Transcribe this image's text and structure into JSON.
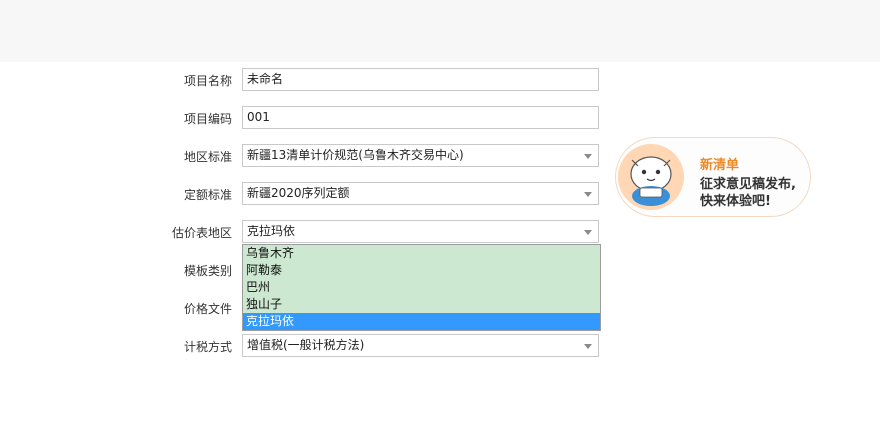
{
  "form": {
    "name_label": "项目名称",
    "name_value": "未命名",
    "code_label": "项目编码",
    "code_value": "001",
    "region_std_label": "地区标准",
    "region_std_value": "新疆13清单计价规范(乌鲁木齐交易中心)",
    "quota_label": "定额标准",
    "quota_value": "新疆2020序列定额",
    "est_region_label": "估价表地区",
    "est_region_value": "克拉玛依",
    "template_label": "模板类别",
    "price_label": "价格文件",
    "tax_label": "计税方式",
    "tax_value": "增值税(一般计税方法)"
  },
  "dropdown": {
    "options": [
      "乌鲁木齐",
      "阿勒泰",
      "巴州",
      "独山子",
      "克拉玛依"
    ],
    "selected": "克拉玛依"
  },
  "banner": {
    "title": "新清单",
    "line1": "征求意见稿发布,",
    "line2": "快来体验吧!",
    "accent": "#ee8a2a"
  },
  "icons": {
    "dropdown_arrow": "chevron-down-icon",
    "mascot": "mascot-icon"
  }
}
